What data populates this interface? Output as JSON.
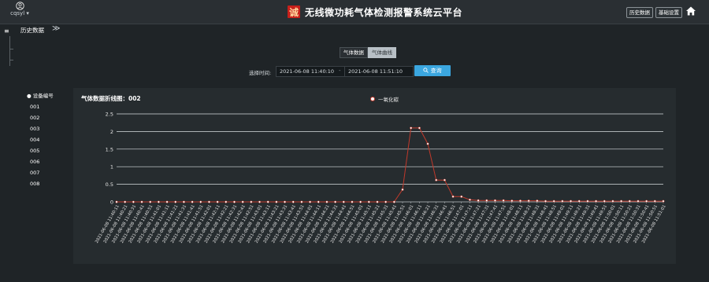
{
  "header": {
    "username": "cqsyl",
    "logo_char": "诚",
    "title": "无线微功耗气体检测报警系统云平台",
    "btn_history": "历史数据",
    "btn_settings": "基础设置"
  },
  "nav": {
    "menu_glyph": "≡",
    "tab_label": "历史数据",
    "tab_arrow": "≫"
  },
  "toggles": {
    "data": "气体数据",
    "curve": "气体曲线",
    "selected": "curve"
  },
  "time": {
    "label": "选择时间:",
    "start": "2021-06-08 11:40:10",
    "end": "2021-06-08 11:51:10",
    "query": "查询"
  },
  "devices": {
    "header": "设备编号",
    "items": [
      "001",
      "002",
      "003",
      "004",
      "005",
      "006",
      "007",
      "008"
    ]
  },
  "colors": {
    "accent": "#3ba7e0",
    "series": "#c0392b"
  },
  "chart_data": {
    "type": "line",
    "title": "气体数据折线图：002",
    "ylim": [
      0,
      2.5
    ],
    "y_ticks": [
      "0",
      "0.5",
      "1",
      "1.5",
      "2",
      "2.5"
    ],
    "x": [
      "2021-06-08 11:40:11",
      "2021-06-08 11:40:21",
      "2021-06-08 11:40:31",
      "2021-06-08 11:40:41",
      "2021-06-08 11:40:51",
      "2021-06-08 11:41:01",
      "2021-06-08 11:41:11",
      "2021-06-08 11:41:21",
      "2021-06-08 11:41:31",
      "2021-06-08 11:41:41",
      "2021-06-08 11:41:51",
      "2021-06-08 11:42:01",
      "2021-06-08 11:42:11",
      "2021-06-08 11:42:21",
      "2021-06-08 11:42:31",
      "2021-06-08 11:42:41",
      "2021-06-08 11:42:51",
      "2021-06-08 11:43:01",
      "2021-06-08 11:43:11",
      "2021-06-08 11:43:21",
      "2021-06-08 11:43:31",
      "2021-06-08 11:43:41",
      "2021-06-08 11:43:51",
      "2021-06-08 11:44:01",
      "2021-06-08 11:44:11",
      "2021-06-08 11:44:21",
      "2021-06-08 11:44:31",
      "2021-06-08 11:44:41",
      "2021-06-08 11:44:51",
      "2021-06-08 11:45:01",
      "2021-06-08 11:45:11",
      "2021-06-08 11:45:21",
      "2021-06-08 11:45:31",
      "2021-06-08 11:45:41",
      "2021-06-08 11:45:51",
      "2021-06-08 11:46:01",
      "2021-06-08 11:46:11",
      "2021-06-08 11:46:21",
      "2021-06-08 11:46:31",
      "2021-06-08 11:46:41",
      "2021-06-08 11:46:51",
      "2021-06-08 11:47:01",
      "2021-06-08 11:47:11",
      "2021-06-08 11:47:21",
      "2021-06-08 11:47:31",
      "2021-06-08 11:47:41",
      "2021-06-08 11:47:51",
      "2021-06-08 11:48:01",
      "2021-06-08 11:48:11",
      "2021-06-08 11:48:21",
      "2021-06-08 11:48:31",
      "2021-06-08 11:48:41",
      "2021-06-08 11:48:51",
      "2021-06-08 11:49:01",
      "2021-06-08 11:49:11",
      "2021-06-08 11:49:21",
      "2021-06-08 11:49:31",
      "2021-06-08 11:49:41",
      "2021-06-08 11:49:51",
      "2021-06-08 11:50:01",
      "2021-06-08 11:50:11",
      "2021-06-08 11:50:21",
      "2021-06-08 11:50:31",
      "2021-06-08 11:50:41",
      "2021-06-08 11:50:51",
      "2021-06-08 11:51:01"
    ],
    "series": [
      {
        "name": "一氧化碳",
        "values": [
          0,
          0,
          0,
          0,
          0,
          0,
          0,
          0,
          0,
          0,
          0,
          0,
          0,
          0,
          0,
          0,
          0,
          0,
          0,
          0,
          0,
          0,
          0,
          0,
          0,
          0,
          0,
          0,
          0,
          0,
          0,
          0,
          0,
          0,
          0.35,
          2.1,
          2.1,
          1.65,
          0.62,
          0.62,
          0.15,
          0.15,
          0.06,
          0.04,
          0.04,
          0.04,
          0.04,
          0.03,
          0.03,
          0.03,
          0.03,
          0.02,
          0.02,
          0.02,
          0.02,
          0.02,
          0.02,
          0.02,
          0.02,
          0.02,
          0.02,
          0.02,
          0.02,
          0.02,
          0.02,
          0.02
        ]
      }
    ]
  }
}
